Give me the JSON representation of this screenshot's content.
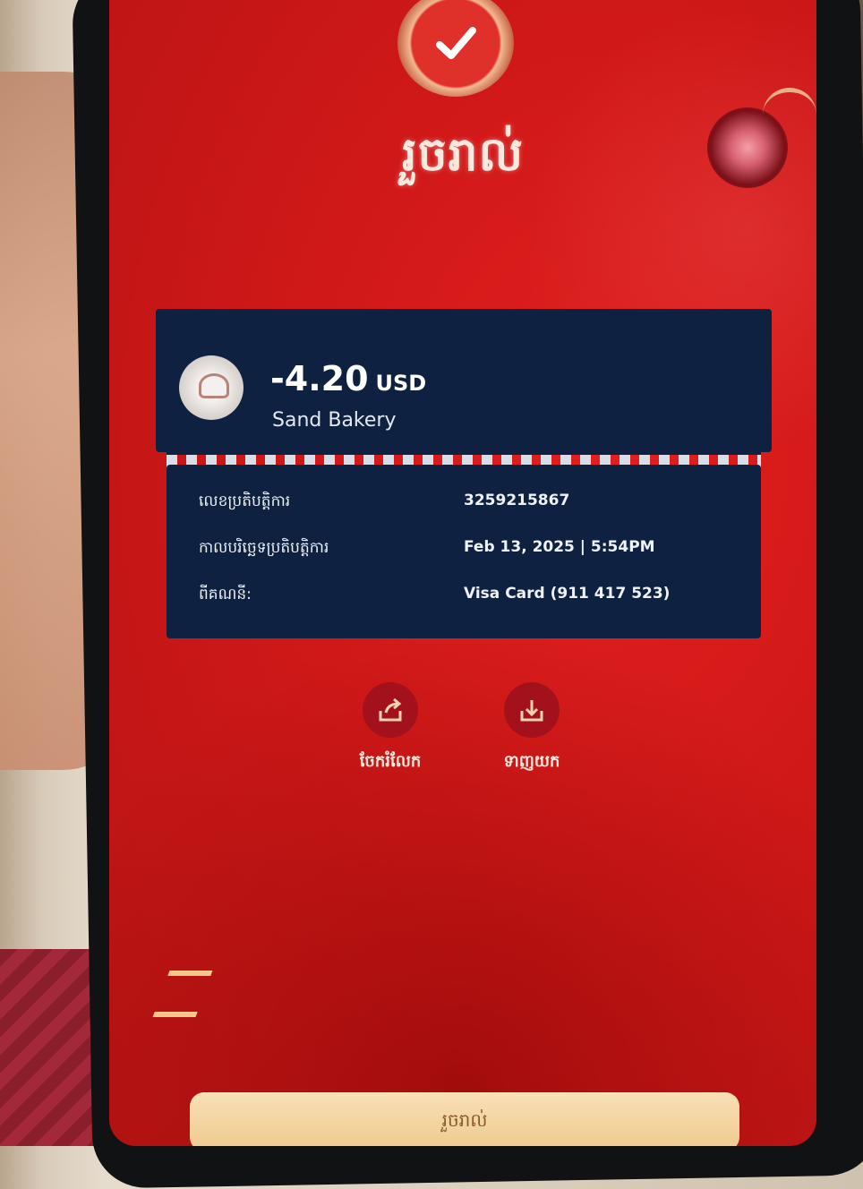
{
  "page": {
    "title": "រួចរាល់",
    "status_icon": "checkmark-icon"
  },
  "transaction": {
    "amount": "-4.20",
    "currency": "USD",
    "merchant": "Sand Bakery",
    "details": [
      {
        "label": "លេខប្រតិបត្តិការ",
        "value": "3259215867"
      },
      {
        "label": "កាលបរិច្ឆេទប្រតិបត្តិការ",
        "value": "Feb 13, 2025 | 5:54PM"
      },
      {
        "label": "ពីគណនី:",
        "value": "Visa Card (911 417 523)"
      }
    ]
  },
  "actions": {
    "share": {
      "label": "ចែករំលែក",
      "icon": "share-icon"
    },
    "save": {
      "label": "ទាញយក",
      "icon": "download-icon"
    }
  },
  "footer": {
    "done_label": "រួចរាល់"
  },
  "colors": {
    "screen_red": "#d01818",
    "card_navy": "#0f2140",
    "gold_button": "#efc98e"
  }
}
